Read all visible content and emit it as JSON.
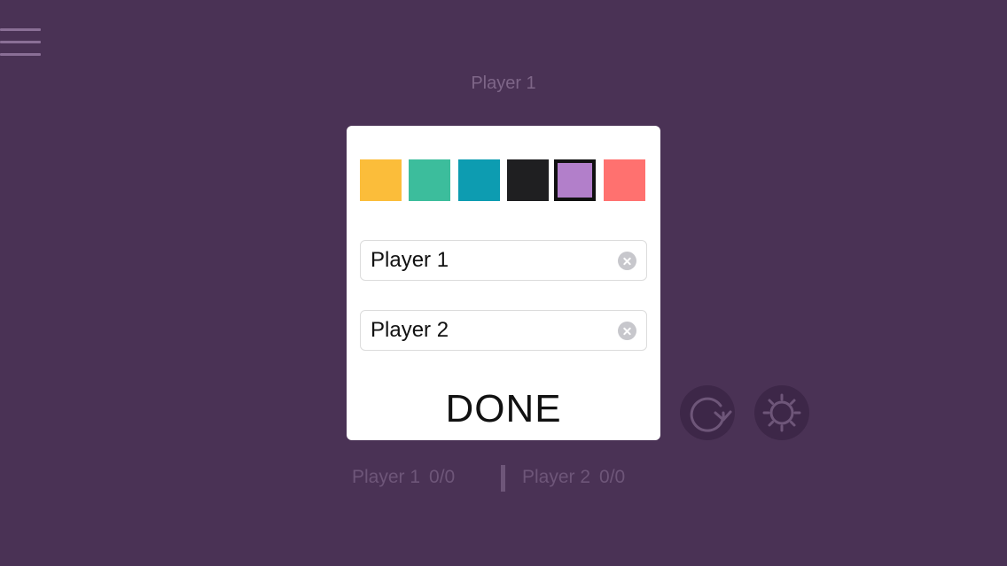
{
  "header": {
    "current_player": "Player 1"
  },
  "menu": {
    "icon": "hamburger-menu-icon"
  },
  "controls": {
    "restart_icon": "restart-icon",
    "settings_icon": "sun-settings-icon"
  },
  "scoreboard": {
    "player1": {
      "name": "Player 1",
      "score": "0/0"
    },
    "player2": {
      "name": "Player 2",
      "score": "0/0"
    }
  },
  "dialog": {
    "colors": [
      {
        "name": "yellow",
        "hex": "#fbbd3a",
        "selected": false
      },
      {
        "name": "green",
        "hex": "#3cbd9c",
        "selected": false
      },
      {
        "name": "teal",
        "hex": "#0d9cb1",
        "selected": false
      },
      {
        "name": "black",
        "hex": "#1f1f21",
        "selected": false
      },
      {
        "name": "purple",
        "hex": "#b27fca",
        "selected": true
      },
      {
        "name": "salmon",
        "hex": "#ff716f",
        "selected": false
      }
    ],
    "player1_value": "Player 1",
    "player2_value": "Player 2",
    "clear_icon": "clear-icon",
    "done_label": "DONE"
  },
  "theme": {
    "background": "#4a3255",
    "dim_text": "#7e6688",
    "button_bg": "#3d2748"
  }
}
